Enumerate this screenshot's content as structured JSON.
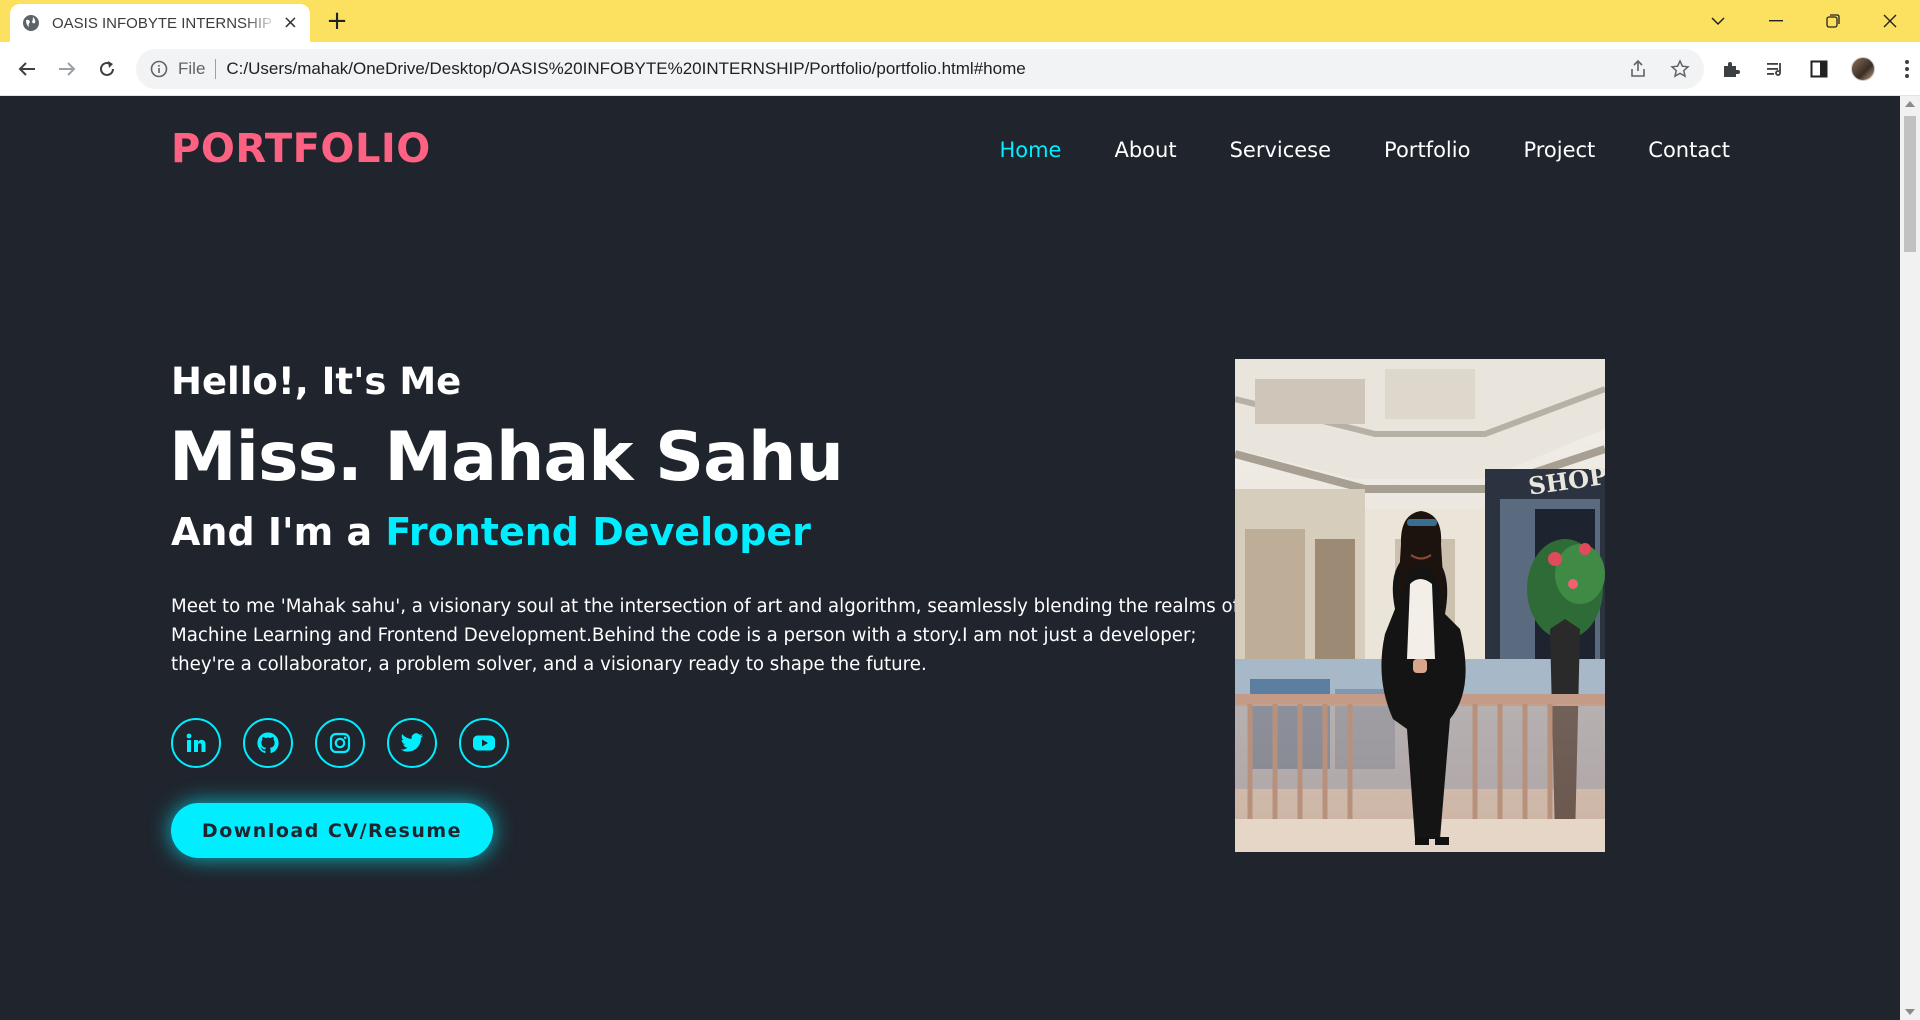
{
  "browser": {
    "tab_title": "OASIS INFOBYTE INTERNSHIP TASK",
    "tab_close": "×",
    "new_tab": "+",
    "omnibox_scheme": "File",
    "url": "C:/Users/mahak/OneDrive/Desktop/OASIS%20INFOBYTE%20INTERNSHIP/Portfolio/portfolio.html#home"
  },
  "header": {
    "logo": "PORTFOLIO",
    "nav": [
      {
        "label": "Home",
        "active": true
      },
      {
        "label": "About"
      },
      {
        "label": "Servicese"
      },
      {
        "label": "Portfolio"
      },
      {
        "label": "Project"
      },
      {
        "label": "Contact"
      }
    ]
  },
  "hero": {
    "greeting": "Hello!, It's Me",
    "name": "Miss. Mahak Sahu",
    "role_prefix": "And I'm a ",
    "role": "Frontend Developer",
    "bio": "Meet to me 'Mahak sahu', a visionary soul at the intersection of art and algorithm, seamlessly blending the realms of Machine Learning and Frontend Development.Behind the code is a person with a story.I am not just a developer; they're a collaborator, a problem solver, and a visionary ready to shape the future.",
    "socials": [
      "linkedin-icon",
      "github-icon",
      "instagram-icon",
      "twitter-icon",
      "youtube-icon"
    ],
    "cta": "Download CV/Resume"
  },
  "colors": {
    "background": "#1f242d",
    "accent": "#00eeff",
    "logo": "#ff6183",
    "chrome": "#fbe15f"
  }
}
